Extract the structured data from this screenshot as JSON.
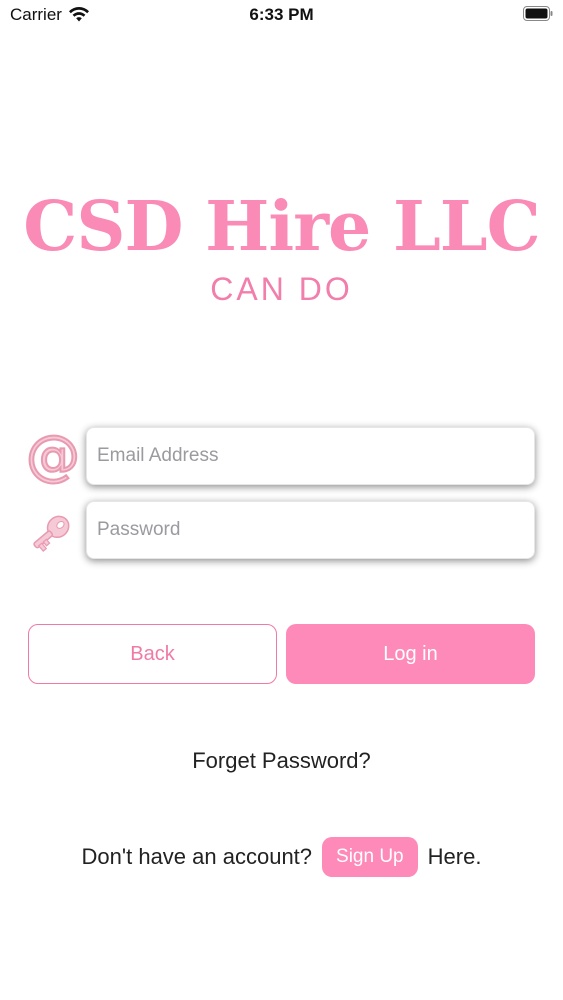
{
  "status_bar": {
    "carrier": "Carrier",
    "time": "6:33 PM",
    "icons": [
      "wifi-icon",
      "battery-icon"
    ]
  },
  "logo": {
    "title": "CSD Hire LLC",
    "subtitle": "CAN DO"
  },
  "form": {
    "email_placeholder": "Email Address",
    "email_value": "",
    "email_icon": "at-sign-icon",
    "password_placeholder": "Password",
    "password_value": "",
    "password_icon": "key-icon"
  },
  "buttons": {
    "back_label": "Back",
    "login_label": "Log in"
  },
  "forgot_password": "Forget Password?",
  "signup": {
    "prefix": "Don't have an account?",
    "button_label": "Sign Up",
    "suffix": "Here."
  },
  "colors": {
    "brand_pink": "#fd8ab8",
    "title_pink": "#f98bb6",
    "outline_pink": "#f07aa6"
  }
}
